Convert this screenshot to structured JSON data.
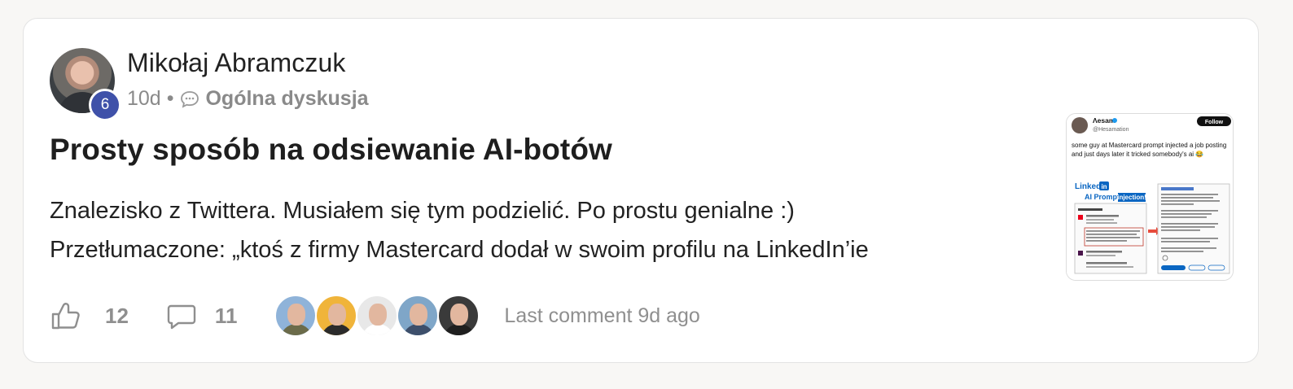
{
  "post": {
    "author": "Mikołaj Abramczuk",
    "level": "6",
    "age": "10d",
    "separator": "•",
    "category": "Ogólna dyskusja",
    "title": "Prosty sposób na odsiewanie AI-botów",
    "body_line1": "Znalezisko z Twittera. Musiałem się tym podzielić. Po prostu genialne :)",
    "body_line2": "Przetłumaczone: „ktoś z firmy Mastercard dodał w swoim profilu na LinkedIn’ie"
  },
  "thumbnail": {
    "name": "Λesam",
    "handle": "@Hesamation",
    "follow_label": "Follow",
    "tweet_text": "some guy at Mastercard prompt injected a job posting and just days later it tricked somebody's ai 😂",
    "linkedin_label": "Linked",
    "linkedin_in": "in",
    "prompt_label": "AI Prompt",
    "injection_label": "injection!"
  },
  "engagement": {
    "likes": "12",
    "comments": "11",
    "last_comment": "Last comment 9d ago"
  },
  "participants": [
    {
      "bg": "#8fb3d9",
      "torso": "#6b6b4a"
    },
    {
      "bg": "#f0b43a",
      "torso": "#2b2b2b"
    },
    {
      "bg": "#e8e8e8",
      "torso": "#ffffff"
    },
    {
      "bg": "#7fa6c8",
      "torso": "#3d4f6b"
    },
    {
      "bg": "#3a3a3a",
      "torso": "#1f1f1f"
    }
  ],
  "colors": {
    "badge": "#3f51a9",
    "muted": "#8a8a8a",
    "linkedin_blue": "#0a66c2"
  }
}
